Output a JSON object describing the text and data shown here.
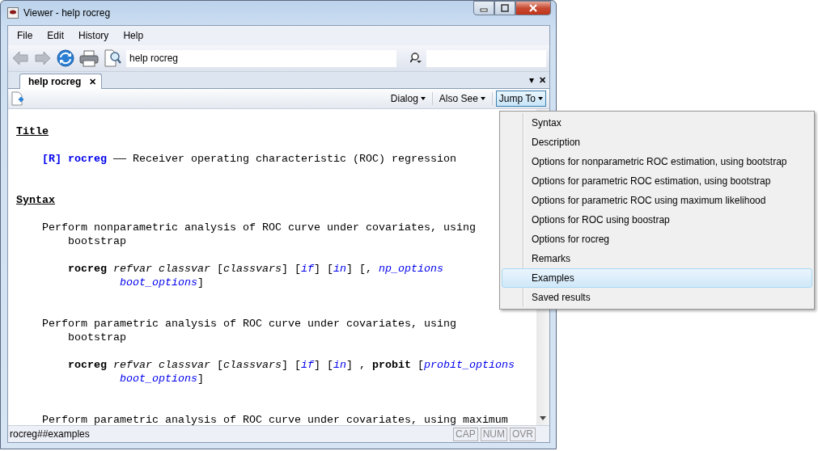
{
  "window": {
    "title": "Viewer - help rocreg"
  },
  "menu_bar": [
    "File",
    "Edit",
    "History",
    "Help"
  ],
  "toolbar": {
    "back_disabled": true,
    "forward_disabled": true,
    "command": "help rocreg"
  },
  "tabs": [
    {
      "label": "help rocreg",
      "close": "✕",
      "selected": true
    }
  ],
  "tab_strip_controls": {
    "menu": "▾",
    "close": "✕"
  },
  "view_buttons": [
    {
      "label": "Dialog",
      "selected": false
    },
    {
      "label": "Also See",
      "selected": false
    },
    {
      "label": "Jump To",
      "selected": true
    }
  ],
  "content": [
    {
      "kind": "heading",
      "segments": [
        {
          "text": "Title",
          "kind": "text"
        }
      ]
    },
    {
      "kind": "entry",
      "segments": [
        {
          "text": "[R]",
          "kind": "link"
        },
        {
          "text": " rocreg",
          "kind": "link"
        },
        {
          "text": " —— Receiver operating characteristic (ROC) regression",
          "kind": "text"
        }
      ]
    },
    {
      "kind": "heading",
      "segments": [
        {
          "text": "Syntax",
          "kind": "text"
        }
      ]
    },
    {
      "kind": "para",
      "segments": [
        {
          "text": "Perform nonparametric analysis of ROC curve under covariates, using",
          "kind": "text"
        }
      ]
    },
    {
      "kind": "para-cont",
      "segments": [
        {
          "text": "bootstrap",
          "kind": "text"
        }
      ]
    },
    {
      "kind": "syntax",
      "segments": [
        {
          "text": "rocreg",
          "kind": "keyword"
        },
        {
          "text": " refvar classvar",
          "kind": "argument"
        },
        {
          "text": " [",
          "kind": "text"
        },
        {
          "text": "classvars",
          "kind": "argument"
        },
        {
          "text": "] [",
          "kind": "text"
        },
        {
          "text": "if",
          "kind": "option-link"
        },
        {
          "text": "] [",
          "kind": "text"
        },
        {
          "text": "in",
          "kind": "option-link"
        },
        {
          "text": "] [, ",
          "kind": "text"
        },
        {
          "text": "np_options",
          "kind": "option-link"
        }
      ]
    },
    {
      "kind": "syntax-cont",
      "segments": [
        {
          "text": "boot_options",
          "kind": "option-link"
        },
        {
          "text": "]",
          "kind": "text"
        }
      ]
    },
    {
      "kind": "para",
      "segments": [
        {
          "text": "Perform parametric analysis of ROC curve under covariates, using",
          "kind": "text"
        }
      ]
    },
    {
      "kind": "para-cont",
      "segments": [
        {
          "text": "bootstrap",
          "kind": "text"
        }
      ]
    },
    {
      "kind": "syntax",
      "segments": [
        {
          "text": "rocreg",
          "kind": "keyword"
        },
        {
          "text": " refvar classvar",
          "kind": "argument"
        },
        {
          "text": " [",
          "kind": "text"
        },
        {
          "text": "classvars",
          "kind": "argument"
        },
        {
          "text": "] [",
          "kind": "text"
        },
        {
          "text": "if",
          "kind": "option-link"
        },
        {
          "text": "] [",
          "kind": "text"
        },
        {
          "text": "in",
          "kind": "option-link"
        },
        {
          "text": "] , ",
          "kind": "text"
        },
        {
          "text": "probit",
          "kind": "keyword"
        },
        {
          "text": " [",
          "kind": "text"
        },
        {
          "text": "probit_options",
          "kind": "option-link"
        }
      ]
    },
    {
      "kind": "syntax-cont",
      "segments": [
        {
          "text": "boot_options",
          "kind": "option-link"
        },
        {
          "text": "]",
          "kind": "text"
        }
      ]
    },
    {
      "kind": "para",
      "segments": [
        {
          "text": "Perform parametric analysis of ROC curve under covariates, using maximum",
          "kind": "text"
        }
      ]
    }
  ],
  "jump_menu": [
    {
      "label": "Syntax",
      "selected": false
    },
    {
      "label": "Description",
      "selected": false
    },
    {
      "label": "Options for nonparametric ROC estimation, using bootstrap",
      "selected": false
    },
    {
      "label": "Options for parametric ROC estimation, using bootstrap",
      "selected": false
    },
    {
      "label": "Options for parametric ROC using maximum likelihood",
      "selected": false
    },
    {
      "label": "Options for ROC using boostrap",
      "selected": false
    },
    {
      "label": "Options for rocreg",
      "selected": false
    },
    {
      "label": "Remarks",
      "selected": false
    },
    {
      "label": "Examples",
      "selected": true
    },
    {
      "label": "Saved results",
      "selected": false
    }
  ],
  "status_bar": {
    "text": "rocreg##examples",
    "indicators": [
      {
        "label": "CAP",
        "disabled": true
      },
      {
        "label": "NUM",
        "disabled": true
      },
      {
        "label": "OVR",
        "disabled": true
      }
    ]
  }
}
